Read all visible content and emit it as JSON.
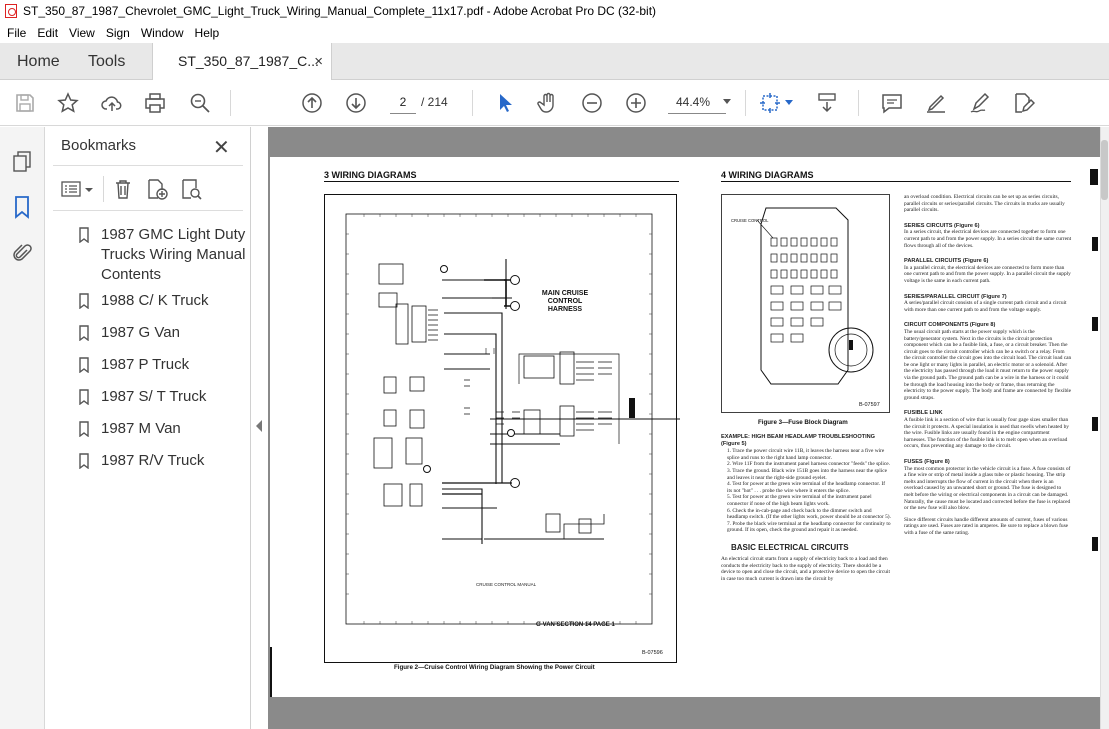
{
  "window": {
    "title": "ST_350_87_1987_Chevrolet_GMC_Light_Truck_Wiring_Manual_Complete_11x17.pdf - Adobe Acrobat Pro DC (32-bit)"
  },
  "menu": [
    "File",
    "Edit",
    "View",
    "Sign",
    "Window",
    "Help"
  ],
  "tabs": {
    "home": "Home",
    "tools": "Tools",
    "document": "ST_350_87_1987_C...",
    "close_glyph": "×"
  },
  "toolbar": {
    "current_page": "2",
    "page_total": "/ 214",
    "zoom": "44.4%"
  },
  "bookmarks": {
    "title": "Bookmarks",
    "close_glyph": "✕",
    "items": [
      "1987 GMC Light Duty Trucks Wiring Manual Contents",
      "1988 C/ K Truck",
      "1987 G Van",
      "1987 P Truck",
      "1987 S/ T Truck",
      "1987 M Van",
      "1987 R/V Truck"
    ]
  },
  "page_left": {
    "header": "3   WIRING DIAGRAMS",
    "harness_label": "MAIN CRUISE\nCONTROL HARNESS",
    "footer_label": "G-VAN   SECTION 14   PAGE 1",
    "ref": "B-07596",
    "caption": "Figure 2—Cruise Control Wiring Diagram Showing the Power Circuit",
    "inner_caption": "CRUISE CONTROL MANUAL"
  },
  "page_right": {
    "header": "4  WIRING DIAGRAMS",
    "fuse_label": "CRUISE CONTROL",
    "fuse_ref": "B-07597",
    "fuse_caption": "Figure 3—Fuse Block Diagram",
    "example_title": "EXAMPLE: HIGH BEAM HEADLAMP TROUBLESHOOTING (Figure 5)",
    "steps": [
      "1. Trace the power circuit wire 11B, it leaves the harness near a five wire splice and runs to the right hand lamp connector.",
      "2. Wire 11F from the instrument panel harness connector \"feeds\" the splice.",
      "3. Trace the ground. Black wire 151B goes into the harness near the splice and leaves it near the right-side ground eyelet.",
      "4. Test for power at the green wire terminal of the headlamp connector. If its not \"hot\" . . . probe the wire where it enters the splice.",
      "5. Test for power at the green wire terminal of the instrument panel connector if none of the high beam lights work.",
      "6. Check the in-cab-page and check back to the dimmer switch and headlamp switch. (If the other lights work, power should be at connector 5).",
      "7. Probe the black wire terminal at the headlamp connector for continuity to ground. If its open, check the ground and repair it as needed."
    ],
    "basic_title": "BASIC ELECTRICAL CIRCUITS",
    "basic_text": "An electrical circuit starts from a supply of electricity back to a load and then conducts the electricity back to the supply of electricity. There should be a device to open and close the circuit, and a protective device to open the circuit in case too much current is drawn into the circuit by",
    "col2_intro": "an overload condition. Electrical circuits can be set up as series circuits, parallel circuits or series/parallel circuits. The circuits in trucks are usually parallel circuits.",
    "series_title": "SERIES CIRCUITS (Figure 6)",
    "series_text": "In a series circuit, the electrical devices are connected together to form one current path to and from the power supply. In a series circuit the same current flows through all of the devices.",
    "parallel_title": "PARALLEL CIRCUITS (Figure 6)",
    "parallel_text": "In a parallel circuit, the electrical devices are connected to form more than one current path to and from the power supply. In a parallel circuit the supply voltage is the same in each current path.",
    "sp_title": "SERIES/PARALLEL CIRCUIT (Figure 7)",
    "sp_text": "A series/parallel circuit consists of a single current path circuit and a circuit with more than one current path to and from the voltage supply.",
    "comp_title": "CIRCUIT COMPONENTS (Figure 8)",
    "comp_text": "The usual circuit path starts at the power supply which is the battery/generator system. Next in the circuits is the circuit protection component which can be a fusible link, a fuse, or a circuit breaker. Then the circuit goes to the circuit controller which can be a switch or a relay. From the circuit controller the circuit goes into the circuit load. The circuit load can be one light or many lights in parallel, an electric motor or a solenoid. After the electricity has passed through the load it must return to the power supply via the ground path. The ground path can be a wire in the harness or it could be through the load housing into the body or frame, thus returning the electricity to the power supply. The body and frame are connected by flexible ground straps.",
    "fl_title": "FUSIBLE LINK",
    "fl_text": "A fusible link is a section of wire that is usually four gage sizes smaller than the circuit it protects. A special insulation is used that swells when heated by the wire. Fusible links are usually found in the engine compartment harnesses. The function of the fusible link is to melt open when an overload occurs, thus preventing any damage to the circuit.",
    "fuses_title": "FUSES (Figure 8)",
    "fuses_text": "The most common protector in the vehicle circuit is a fuse. A fuse consists of a fine wire or strip of metal inside a glass tube or plastic housing. The strip melts and interrupts the flow of current in the circuit when there is an overload caused by an unwanted short or ground. The fuse is designed to melt before the wiring or electrical components in a circuit can be damaged. Naturally, the cause must be located and corrected before the fuse is replaced or the new fuse will also blow.",
    "fuses_text2": "Since different circuits handle different amounts of current, fuses of various ratings are used. Fuses are rated in amperes. Be sure to replace a blown fuse with a fuse of the same rating."
  }
}
